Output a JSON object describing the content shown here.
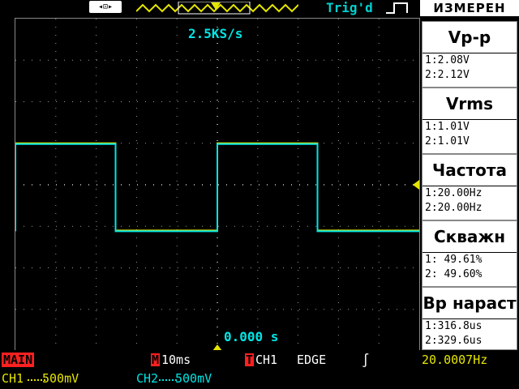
{
  "top_bar": {
    "usb_icon": "usb-icon",
    "trigger_status": "Trig'd",
    "trigger_edge_icon": "rising-edge-icon"
  },
  "screen": {
    "sample_rate": "2.5KS/s",
    "trigger_time": "0.000 s"
  },
  "panel": {
    "title": "ИЗМЕРЕН",
    "measurements": [
      {
        "name": "Vp-p",
        "ch1": "1:2.08V",
        "ch2": "2:2.12V"
      },
      {
        "name": "Vrms",
        "ch1": "1:1.01V",
        "ch2": "2:1.01V"
      },
      {
        "name": "Частота",
        "ch1": "1:20.00Hz",
        "ch2": "2:20.00Hz"
      },
      {
        "name": "Скважн",
        "ch1": "1: 49.61%",
        "ch2": "2: 49.60%"
      },
      {
        "name": "Вр нараст",
        "ch1": "1:316.8us",
        "ch2": "2:329.6us"
      }
    ]
  },
  "status": {
    "main": "MAIN",
    "m_badge": "M",
    "timebase": "10ms",
    "t_badge": "T",
    "trigger_source": "CH1",
    "trigger_type": "EDGE",
    "slope_icon": "rising-slope-icon",
    "frequency": "20.0007Hz",
    "ch1_label": "CH1",
    "ch1_scale": "500mV",
    "ch2_label": "CH2",
    "ch2_scale": "500mV"
  },
  "colors": {
    "ch1": "#e6e600",
    "ch2": "#00e5e5",
    "accent_red": "#ff2020",
    "grid": "#9a9a9a"
  },
  "waveform": {
    "type": "square",
    "frequency_hz": 20.0,
    "duty_cycle_percent": 49.6,
    "high_div": 1.0,
    "low_div": -1.1
  }
}
